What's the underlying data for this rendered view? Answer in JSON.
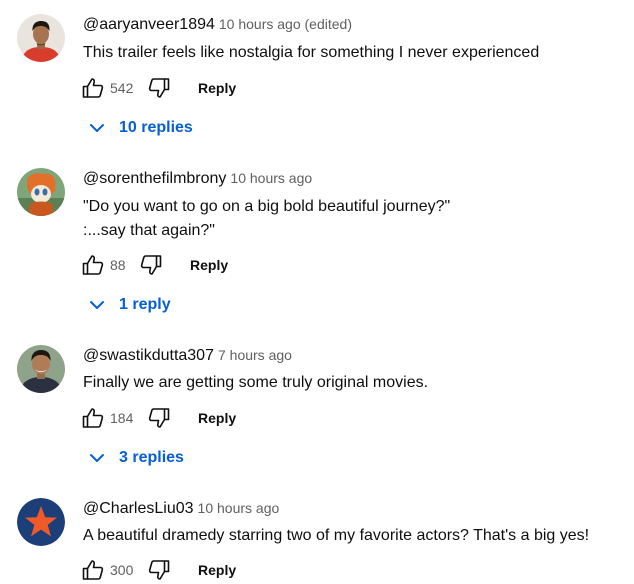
{
  "comments": [
    {
      "author": "@aaryanveer1894",
      "time": "10 hours ago (edited)",
      "text": "This trailer feels like nostalgia for something I never experienced",
      "likes": "542",
      "reply_label": "Reply",
      "replies_label": "10 replies"
    },
    {
      "author": "@sorenthefilmbrony",
      "time": "10 hours ago",
      "text": "\"Do you want to go on a big bold beautiful journey?\"\n:...say that again?\"",
      "likes": "88",
      "reply_label": "Reply",
      "replies_label": "1 reply"
    },
    {
      "author": "@swastikdutta307",
      "time": "7 hours ago",
      "text": "Finally we are getting some truly original movies.",
      "likes": "184",
      "reply_label": "Reply",
      "replies_label": "3 replies"
    },
    {
      "author": "@CharlesLiu03",
      "time": "10 hours ago",
      "text": "A beautiful dramedy starring two of my favorite actors? That's a big yes!",
      "likes": "300",
      "reply_label": "Reply"
    }
  ],
  "icons": {
    "like": "thumb-up-icon",
    "dislike": "thumb-down-icon",
    "expand": "chevron-down-icon"
  },
  "colors": {
    "link_blue": "#065fd4",
    "meta_gray": "#606060",
    "text": "#0f0f0f"
  }
}
